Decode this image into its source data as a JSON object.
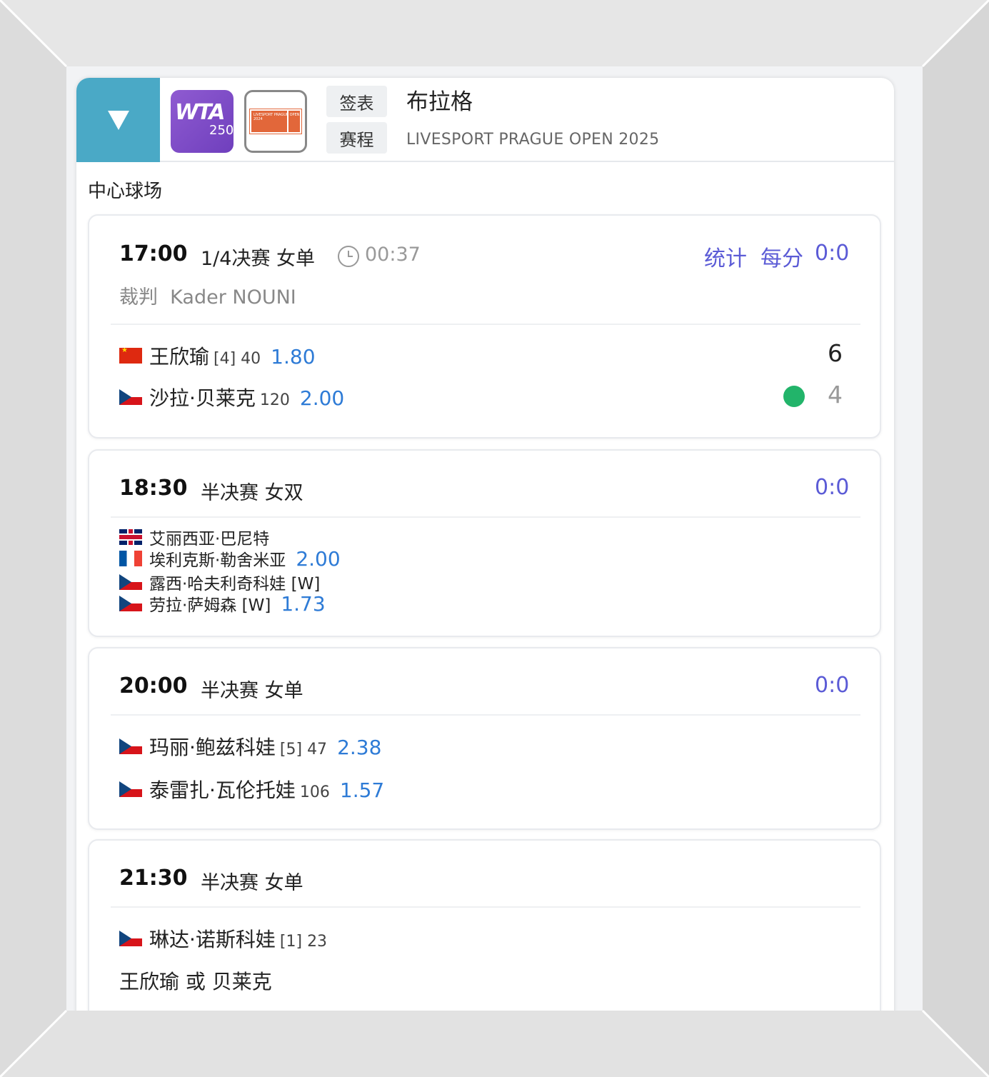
{
  "header": {
    "toggle_icon": "triangle-down-icon",
    "wta_logo_text": "WTA",
    "wta_logo_level": "250",
    "event_logo_text": "LIVESPORT PRAGUE OPEN 2024",
    "draw_label": "签表",
    "schedule_label": "赛程",
    "city": "布拉格",
    "tournament": "LIVESPORT PRAGUE OPEN 2025",
    "accent_color": "#4aa9c6"
  },
  "court": "中心球场",
  "matches": [
    {
      "time": "17:00",
      "round": "1/4决赛 女单",
      "elapsed": "00:37",
      "stats_label": "统计",
      "point_label": "每分",
      "point_score": "0:0",
      "referee_label": "裁判",
      "referee_name": "Kader NOUNI",
      "players": [
        {
          "flag": "cn",
          "name": "王欣瑜",
          "meta": "[4] 40",
          "odds": "1.80",
          "score": "6"
        },
        {
          "flag": "cz",
          "name": "沙拉·贝莱克",
          "meta": "120",
          "odds": "2.00",
          "score": "4",
          "serving": true
        }
      ]
    },
    {
      "time": "18:30",
      "round": "半决赛 女双",
      "point_score": "0:0",
      "players": [
        {
          "flag": "gb",
          "name": "艾丽西亚·巴尼特",
          "odds": ""
        },
        {
          "flag": "fr",
          "name": "埃利克斯·勒舍米亚",
          "odds": "2.00"
        },
        {
          "flag": "cz",
          "name": "露西·哈夫利奇科娃 [W]",
          "odds": ""
        },
        {
          "flag": "cz",
          "name": "劳拉·萨姆森 [W]",
          "odds": "1.73"
        }
      ]
    },
    {
      "time": "20:00",
      "round": "半决赛 女单",
      "point_score": "0:0",
      "players": [
        {
          "flag": "cz",
          "name": "玛丽·鲍兹科娃",
          "meta": "[5] 47",
          "odds": "2.38"
        },
        {
          "flag": "cz",
          "name": "泰雷扎·瓦伦托娃",
          "meta": "106",
          "odds": "1.57"
        }
      ]
    },
    {
      "time": "21:30",
      "round": "半决赛 女单",
      "players": [
        {
          "flag": "cz",
          "name": "琳达·诺斯科娃",
          "meta": "[1] 23"
        }
      ],
      "opponent_text": "王欣瑜 或 贝莱克"
    }
  ]
}
